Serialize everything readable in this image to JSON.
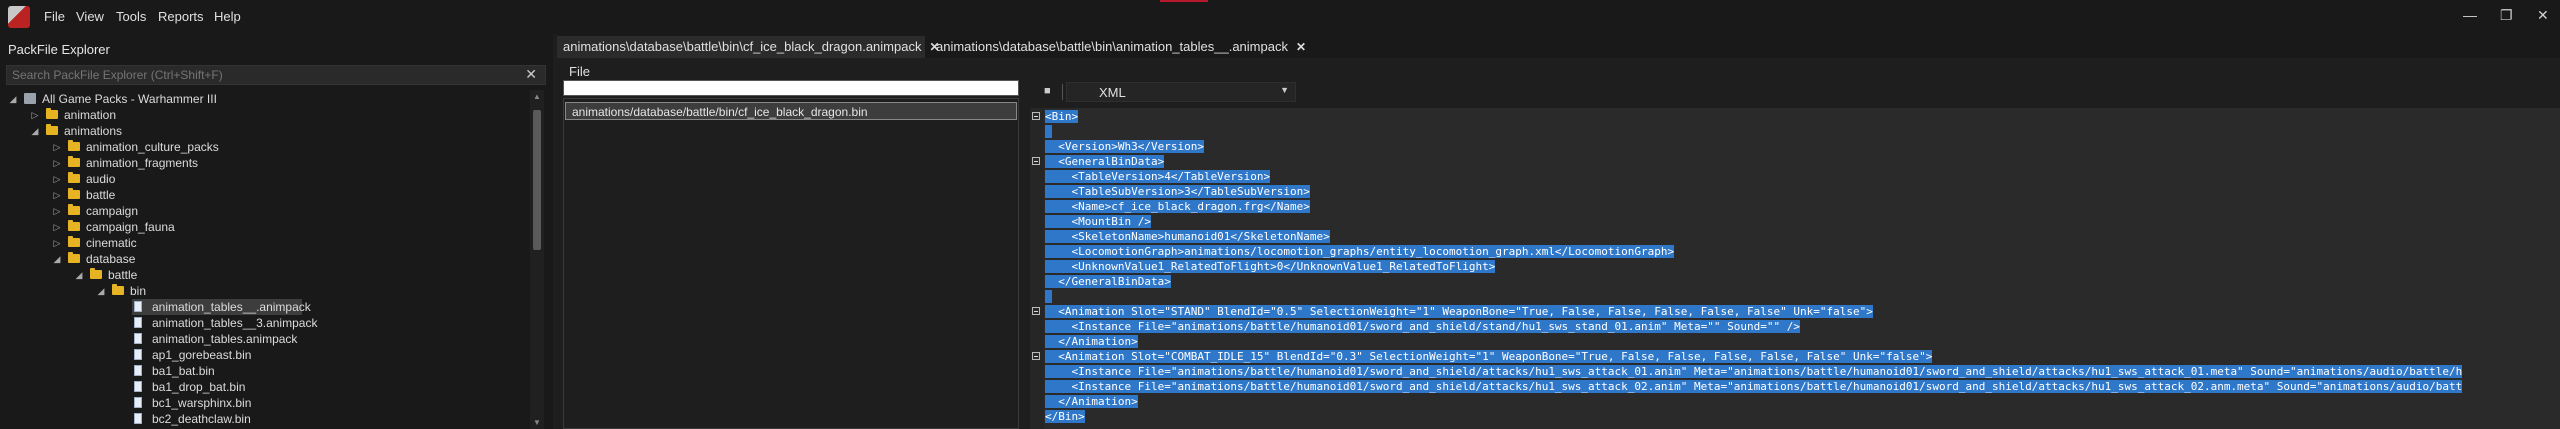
{
  "menu": [
    "File",
    "View",
    "Tools",
    "Reports",
    "Help"
  ],
  "window_controls": {
    "minimize": "—",
    "restore": "❐",
    "close": "✕"
  },
  "explorer": {
    "title": "PackFile Explorer",
    "search_placeholder": "Search PackFile Explorer (Ctrl+Shift+F)",
    "clear": "✕",
    "tree": [
      {
        "label": "All Game Packs - Warhammer III",
        "depth": 0,
        "type": "pack",
        "arrow": "open"
      },
      {
        "label": "animation",
        "depth": 1,
        "type": "folder",
        "arrow": "closed"
      },
      {
        "label": "animations",
        "depth": 1,
        "type": "folder",
        "arrow": "open"
      },
      {
        "label": "animation_culture_packs",
        "depth": 2,
        "type": "folder",
        "arrow": "closed"
      },
      {
        "label": "animation_fragments",
        "depth": 2,
        "type": "folder",
        "arrow": "closed"
      },
      {
        "label": "audio",
        "depth": 2,
        "type": "folder",
        "arrow": "closed"
      },
      {
        "label": "battle",
        "depth": 2,
        "type": "folder",
        "arrow": "closed"
      },
      {
        "label": "campaign",
        "depth": 2,
        "type": "folder",
        "arrow": "closed"
      },
      {
        "label": "campaign_fauna",
        "depth": 2,
        "type": "folder",
        "arrow": "closed"
      },
      {
        "label": "cinematic",
        "depth": 2,
        "type": "folder",
        "arrow": "closed"
      },
      {
        "label": "database",
        "depth": 2,
        "type": "folder",
        "arrow": "open"
      },
      {
        "label": "battle",
        "depth": 3,
        "type": "folder",
        "arrow": "open"
      },
      {
        "label": "bin",
        "depth": 4,
        "type": "folder",
        "arrow": "open"
      },
      {
        "label": "animation_tables__.animpack",
        "depth": 5,
        "type": "file",
        "arrow": "",
        "selected": true
      },
      {
        "label": "animation_tables__3.animpack",
        "depth": 5,
        "type": "file",
        "arrow": ""
      },
      {
        "label": "animation_tables.animpack",
        "depth": 5,
        "type": "file",
        "arrow": ""
      },
      {
        "label": "ap1_gorebeast.bin",
        "depth": 5,
        "type": "file",
        "arrow": ""
      },
      {
        "label": "ba1_bat.bin",
        "depth": 5,
        "type": "file",
        "arrow": ""
      },
      {
        "label": "ba1_drop_bat.bin",
        "depth": 5,
        "type": "file",
        "arrow": ""
      },
      {
        "label": "bc1_warsphinx.bin",
        "depth": 5,
        "type": "file",
        "arrow": ""
      },
      {
        "label": "bc2_deathclaw.bin",
        "depth": 5,
        "type": "file",
        "arrow": ""
      }
    ]
  },
  "tabs": [
    {
      "label": "animations\\database\\battle\\bin\\cf_ice_black_dragon.animpack",
      "close": "✕",
      "active": true
    },
    {
      "label": "animations\\database\\battle\\bin\\animation_tables__.animpack",
      "close": "✕",
      "active": false
    }
  ],
  "packed_files": {
    "menu_label": "File",
    "filter_value": "",
    "items": [
      "animations/database/battle/bin/cf_ice_black_dragon.bin"
    ]
  },
  "editor": {
    "language": "XML",
    "lines": [
      "<Bin>",
      "",
      "  <Version>Wh3</Version>",
      "  <GeneralBinData>",
      "    <TableVersion>4</TableVersion>",
      "    <TableSubVersion>3</TableSubVersion>",
      "    <Name>cf_ice_black_dragon.frg</Name>",
      "    <MountBin />",
      "    <SkeletonName>humanoid01</SkeletonName>",
      "    <LocomotionGraph>animations/locomotion_graphs/entity_locomotion_graph.xml</LocomotionGraph>",
      "    <UnknownValue1_RelatedToFlight>0</UnknownValue1_RelatedToFlight>",
      "  </GeneralBinData>",
      "",
      "  <Animation Slot=\"STAND\" BlendId=\"0.5\" SelectionWeight=\"1\" WeaponBone=\"True, False, False, False, False, False\" Unk=\"false\">",
      "    <Instance File=\"animations/battle/humanoid01/sword_and_shield/stand/hu1_sws_stand_01.anim\" Meta=\"\" Sound=\"\" />",
      "  </Animation>",
      "  <Animation Slot=\"COMBAT_IDLE_15\" BlendId=\"0.3\" SelectionWeight=\"1\" WeaponBone=\"True, False, False, False, False, False\" Unk=\"false\">",
      "    <Instance File=\"animations/battle/humanoid01/sword_and_shield/attacks/hu1_sws_attack_01.anim\" Meta=\"animations/battle/humanoid01/sword_and_shield/attacks/hu1_sws_attack_01.meta\" Sound=\"animations/audio/battle/h",
      "    <Instance File=\"animations/battle/humanoid01/sword_and_shield/attacks/hu1_sws_attack_02.anim\" Meta=\"animations/battle/humanoid01/sword_and_shield/attacks/hu1_sws_attack_02.anm.meta\" Sound=\"animations/audio/batt",
      "  </Animation>",
      "</Bin>"
    ],
    "fold_lines": [
      0,
      3,
      13,
      16
    ]
  },
  "colors": {
    "selection": "#2f77c9",
    "folder": "#e6b422",
    "accent_red": "#b5182b"
  }
}
